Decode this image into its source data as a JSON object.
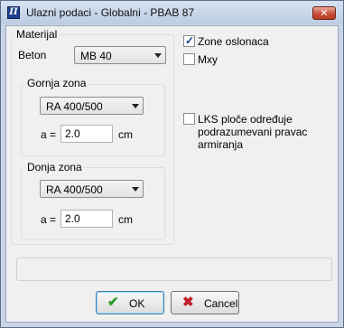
{
  "window": {
    "title": "Ulazni podaci - Globalni - PBAB 87",
    "close_glyph": "✕"
  },
  "material": {
    "legend": "Materijal",
    "beton_label": "Beton",
    "beton_value": "MB 40",
    "upper_zone": {
      "legend": "Gornja zona",
      "rebar_value": "RA 400/500",
      "a_label": "a =",
      "a_value": "2.0",
      "unit": "cm"
    },
    "lower_zone": {
      "legend": "Donja zona",
      "rebar_value": "RA 400/500",
      "a_label": "a =",
      "a_value": "2.0",
      "unit": "cm"
    }
  },
  "options": {
    "zone_oslonaca": {
      "label": "Zone oslonaca",
      "checked": true
    },
    "mxy": {
      "label": "Mxy",
      "checked": false
    },
    "lks": {
      "label_lines": [
        "LKS ploče određuje",
        "podrazumevani pravac",
        "armiranja"
      ],
      "checked": false
    }
  },
  "buttons": {
    "ok": "OK",
    "cancel": "Cancel"
  },
  "colors": {
    "ok_icon": "#2a9a2a",
    "cancel_icon": "#c0202a",
    "check_mark": "#1a3e8c"
  },
  "icons": {
    "app": "app-icon",
    "ok": "checkmark-icon",
    "cancel": "x-icon",
    "close": "close-icon"
  }
}
